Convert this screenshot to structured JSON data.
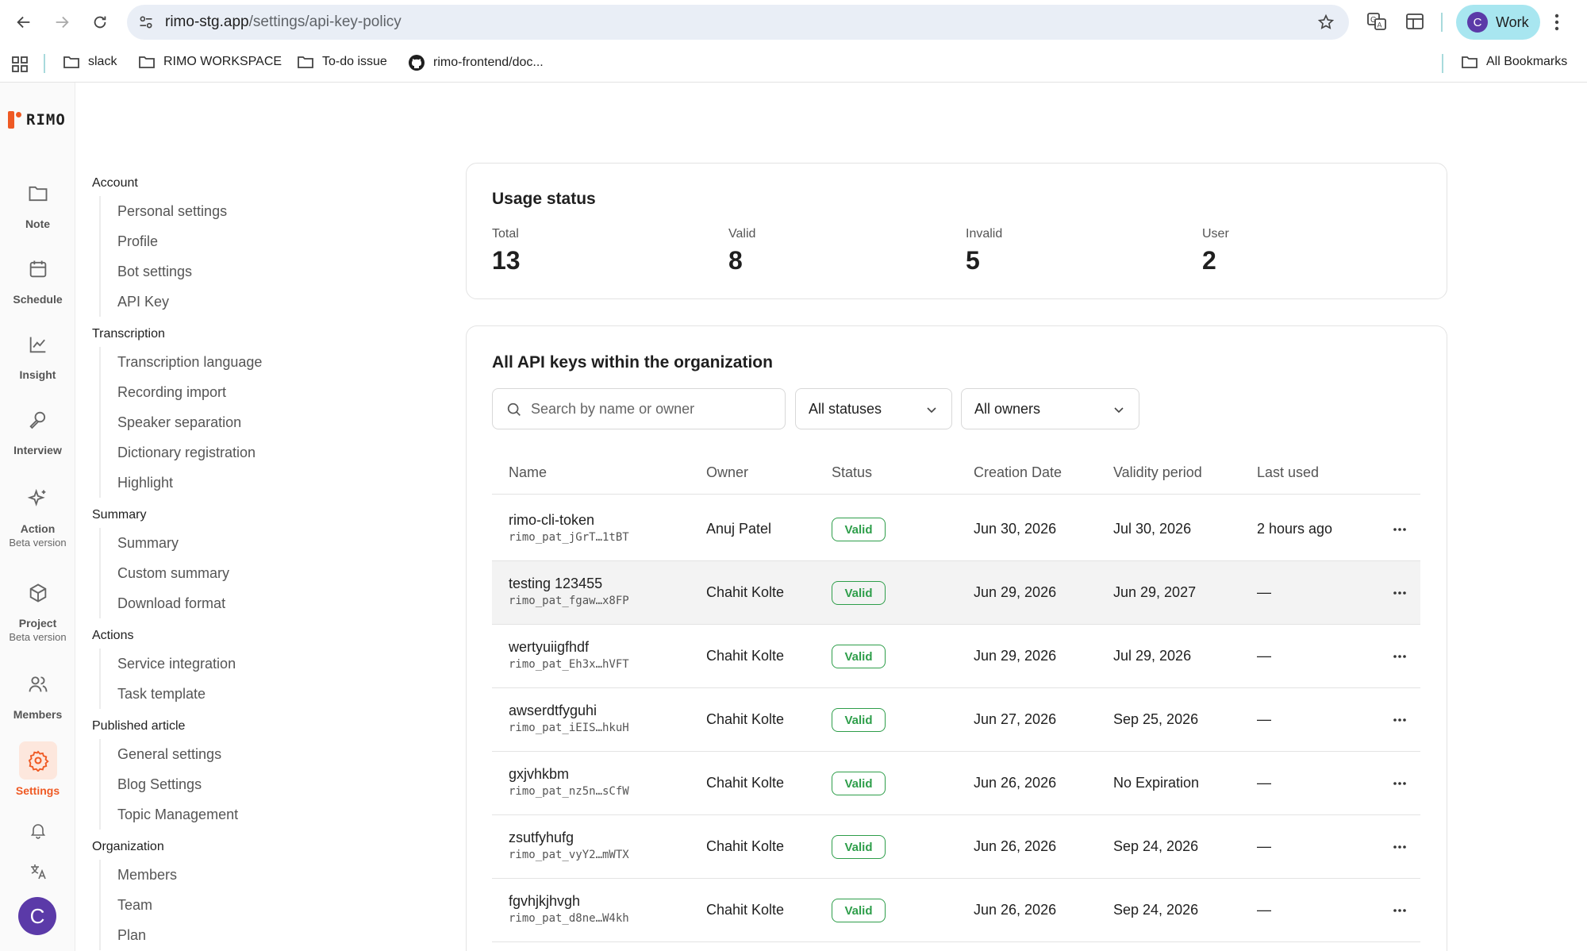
{
  "browser": {
    "url_host": "rimo-stg.app",
    "url_path": "/settings/api-key-policy",
    "profile_initial": "C",
    "profile_label": "Work",
    "bookmarks": [
      {
        "label": "slack",
        "icon": "folder-icon"
      },
      {
        "label": "RIMO WORKSPACE",
        "icon": "folder-icon"
      },
      {
        "label": "To-do issue",
        "icon": "folder-icon"
      },
      {
        "label": "rimo-frontend/doc...",
        "icon": "github-icon"
      }
    ],
    "all_bookmarks": "All Bookmarks"
  },
  "rail": {
    "logo": "RIMO",
    "items": [
      {
        "label": "Note",
        "sub": "",
        "icon": "folder-icon"
      },
      {
        "label": "Schedule",
        "sub": "",
        "icon": "calendar-icon"
      },
      {
        "label": "Insight",
        "sub": "",
        "icon": "chart-icon"
      },
      {
        "label": "Interview",
        "sub": "",
        "icon": "microphone-icon"
      },
      {
        "label": "Action",
        "sub": "Beta version",
        "icon": "sparkle-icon"
      },
      {
        "label": "Project",
        "sub": "Beta version",
        "icon": "cube-icon"
      },
      {
        "label": "Members",
        "sub": "",
        "icon": "users-icon"
      },
      {
        "label": "Settings",
        "sub": "",
        "icon": "gear-icon",
        "active": true
      }
    ],
    "avatar_initial": "C",
    "accent": "#ef5a24"
  },
  "settings_nav": {
    "sections": [
      {
        "title": "Account",
        "items": [
          "Personal settings",
          "Profile",
          "Bot settings",
          "API Key"
        ]
      },
      {
        "title": "Transcription",
        "items": [
          "Transcription language",
          "Recording import",
          "Speaker separation",
          "Dictionary registration",
          "Highlight"
        ]
      },
      {
        "title": "Summary",
        "items": [
          "Summary",
          "Custom summary",
          "Download format"
        ]
      },
      {
        "title": "Actions",
        "items": [
          "Service integration",
          "Task template"
        ]
      },
      {
        "title": "Published article",
        "items": [
          "General settings",
          "Blog Settings",
          "Topic Management"
        ]
      },
      {
        "title": "Organization",
        "items": [
          "Members",
          "Team",
          "Plan"
        ]
      }
    ]
  },
  "usage": {
    "title": "Usage status",
    "stats": [
      {
        "label": "Total",
        "value": "13"
      },
      {
        "label": "Valid",
        "value": "8"
      },
      {
        "label": "Invalid",
        "value": "5"
      },
      {
        "label": "User",
        "value": "2"
      }
    ]
  },
  "keys": {
    "title": "All API keys within the organization",
    "search_placeholder": "Search by name or owner",
    "status_filter": "All statuses",
    "owner_filter": "All owners",
    "columns": [
      "Name",
      "Owner",
      "Status",
      "Creation Date",
      "Validity period",
      "Last used"
    ],
    "status_color": "#2e9e4a",
    "rows": [
      {
        "name": "rimo-cli-token",
        "token": "rimo_pat_jGrT…1tBT",
        "owner": "Anuj Patel",
        "status": "Valid",
        "created": "Jun 30, 2026",
        "validity": "Jul 30, 2026",
        "last_used": "2 hours ago"
      },
      {
        "name": "testing 123455",
        "token": "rimo_pat_fgaw…x8FP",
        "owner": "Chahit Kolte",
        "status": "Valid",
        "created": "Jun 29, 2026",
        "validity": "Jun 29, 2027",
        "last_used": "—"
      },
      {
        "name": "wertyuiigfhdf",
        "token": "rimo_pat_Eh3x…hVFT",
        "owner": "Chahit Kolte",
        "status": "Valid",
        "created": "Jun 29, 2026",
        "validity": "Jul 29, 2026",
        "last_used": "—"
      },
      {
        "name": "awserdtfyguhi",
        "token": "rimo_pat_iEIS…hkuH",
        "owner": "Chahit Kolte",
        "status": "Valid",
        "created": "Jun 27, 2026",
        "validity": "Sep 25, 2026",
        "last_used": "—"
      },
      {
        "name": "gxjvhkbm",
        "token": "rimo_pat_nz5n…sCfW",
        "owner": "Chahit Kolte",
        "status": "Valid",
        "created": "Jun 26, 2026",
        "validity": "No Expiration",
        "last_used": "—"
      },
      {
        "name": "zsutfyhufg",
        "token": "rimo_pat_vyY2…mWTX",
        "owner": "Chahit Kolte",
        "status": "Valid",
        "created": "Jun 26, 2026",
        "validity": "Sep 24, 2026",
        "last_used": "—"
      },
      {
        "name": "fgvhjkjhvgh",
        "token": "rimo_pat_d8ne…W4kh",
        "owner": "Chahit Kolte",
        "status": "Valid",
        "created": "Jun 26, 2026",
        "validity": "Sep 24, 2026",
        "last_used": "—"
      }
    ]
  }
}
